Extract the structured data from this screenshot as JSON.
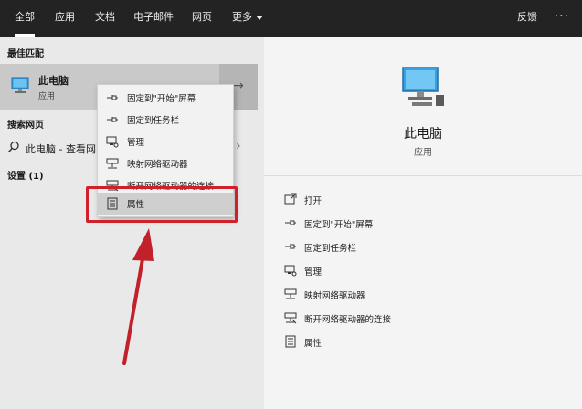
{
  "topbar": {
    "tabs": [
      "全部",
      "应用",
      "文档",
      "电子邮件",
      "网页",
      "更多"
    ],
    "feedback": "反馈",
    "more_options": "···"
  },
  "left": {
    "best_match_label": "最佳匹配",
    "best_match": {
      "title": "此电脑",
      "subtitle": "应用",
      "arrow": "→"
    },
    "web_search_label": "搜索网页",
    "web_search_text": "此电脑 - 查看网",
    "settings_label": "设置 (1)"
  },
  "context_menu": {
    "items": [
      {
        "label": "固定到\"开始\"屏幕",
        "icon": "pin-icon"
      },
      {
        "label": "固定到任务栏",
        "icon": "pin-icon"
      },
      {
        "label": "管理",
        "icon": "manage-icon"
      },
      {
        "label": "映射网络驱动器",
        "icon": "network-drive-icon"
      },
      {
        "label": "断开网络驱动器的连接",
        "icon": "disconnect-drive-icon"
      },
      {
        "label": "属性",
        "icon": "properties-icon"
      }
    ]
  },
  "right": {
    "title": "此电脑",
    "subtitle": "应用",
    "actions": [
      {
        "label": "打开",
        "icon": "open-icon"
      },
      {
        "label": "固定到\"开始\"屏幕",
        "icon": "pin-icon"
      },
      {
        "label": "固定到任务栏",
        "icon": "pin-icon"
      },
      {
        "label": "管理",
        "icon": "manage-icon"
      },
      {
        "label": "映射网络驱动器",
        "icon": "network-drive-icon"
      },
      {
        "label": "断开网络驱动器的连接",
        "icon": "disconnect-drive-icon"
      },
      {
        "label": "属性",
        "icon": "properties-icon"
      }
    ]
  },
  "colors": {
    "topbar": "#232323",
    "highlight_box": "#d0202a",
    "annotation_arrow": "#c2202a",
    "monitor": "#3aa0e0"
  }
}
